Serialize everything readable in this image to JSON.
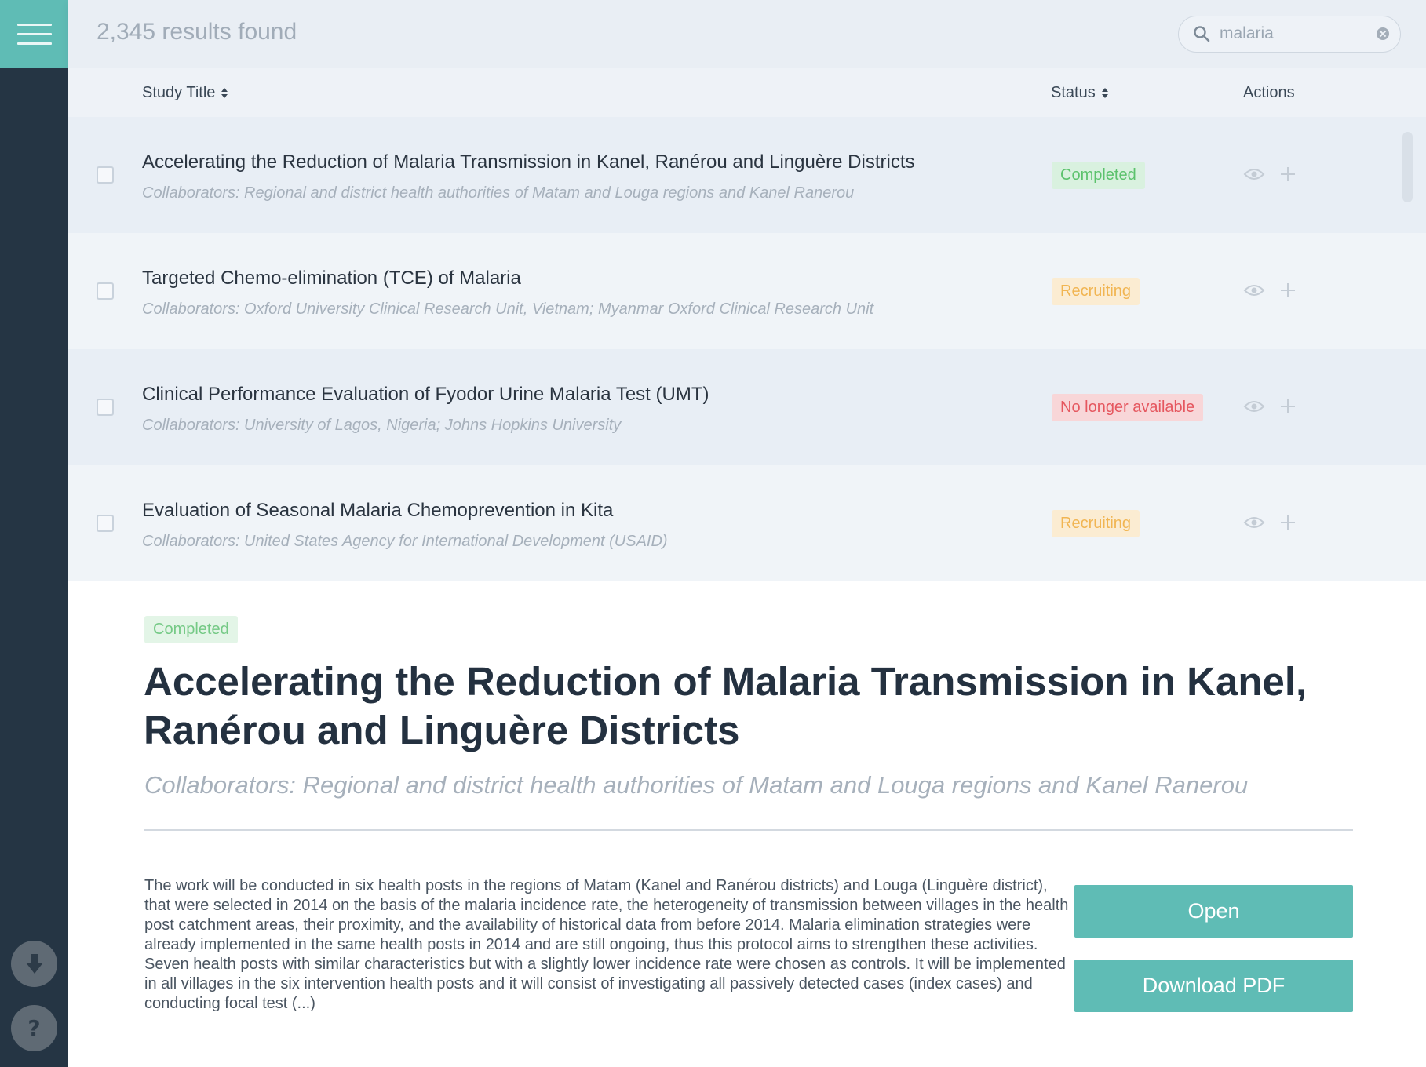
{
  "results": {
    "count_text": "2,345 results found"
  },
  "search": {
    "value": "malaria"
  },
  "table": {
    "columns": {
      "title": "Study Title",
      "status": "Status",
      "actions": "Actions"
    },
    "rows": [
      {
        "title": "Accelerating the Reduction of Malaria Transmission in Kanel, Ranérou and Linguère Districts",
        "collaborators": "Collaborators: Regional and district health authorities of Matam and Louga regions and Kanel Ranerou",
        "status": "Completed"
      },
      {
        "title": "Targeted Chemo-elimination (TCE) of Malaria",
        "collaborators": "Collaborators: Oxford University Clinical Research Unit, Vietnam; Myanmar Oxford Clinical Research Unit",
        "status": "Recruiting"
      },
      {
        "title": "Clinical Performance Evaluation of Fyodor Urine Malaria Test (UMT)",
        "collaborators": "Collaborators: University of Lagos, Nigeria; Johns Hopkins University",
        "status": "No longer available"
      },
      {
        "title": "Evaluation of Seasonal Malaria Chemoprevention in Kita",
        "collaborators": "Collaborators: United States Agency for International Development (USAID)",
        "status": "Recruiting"
      }
    ]
  },
  "detail": {
    "status": "Completed",
    "title": "Accelerating the Reduction of Malaria Transmission in Kanel, Ranérou and Linguère Districts",
    "collaborators": "Collaborators: Regional and district health authorities of Matam and Louga regions and Kanel Ranerou",
    "description": "The work will be conducted in six health posts in the regions of Matam (Kanel and Ranérou districts) and Louga (Linguère district), that were selected in 2014 on the basis of the malaria incidence rate, the heterogeneity of transmission between villages in the health post catchment areas, their proximity, and the availability of historical data from before 2014. Malaria elimination strategies were already implemented in the same health posts in 2014 and are still ongoing, thus this protocol aims to strengthen these activities. Seven health posts with similar characteristics but with a slightly lower incidence rate were chosen as controls. It will be implemented in all villages in the six intervention health posts and it will consist of investigating all passively detected cases (index cases) and conducting focal test (...)",
    "open_label": "Open",
    "pdf_label": "Download PDF"
  },
  "icons": {
    "menu": "hamburger-menu-icon",
    "search": "search-icon",
    "clear": "clear-icon",
    "view": "eye-icon",
    "add": "plus-icon",
    "download": "download-arrow-icon",
    "help": "question-icon"
  },
  "colors": {
    "accent": "#5fbcb5",
    "sidebar": "#253544",
    "completed": "#5cc26d",
    "recruiting": "#f1b552",
    "no_longer_available": "#e5575f"
  }
}
